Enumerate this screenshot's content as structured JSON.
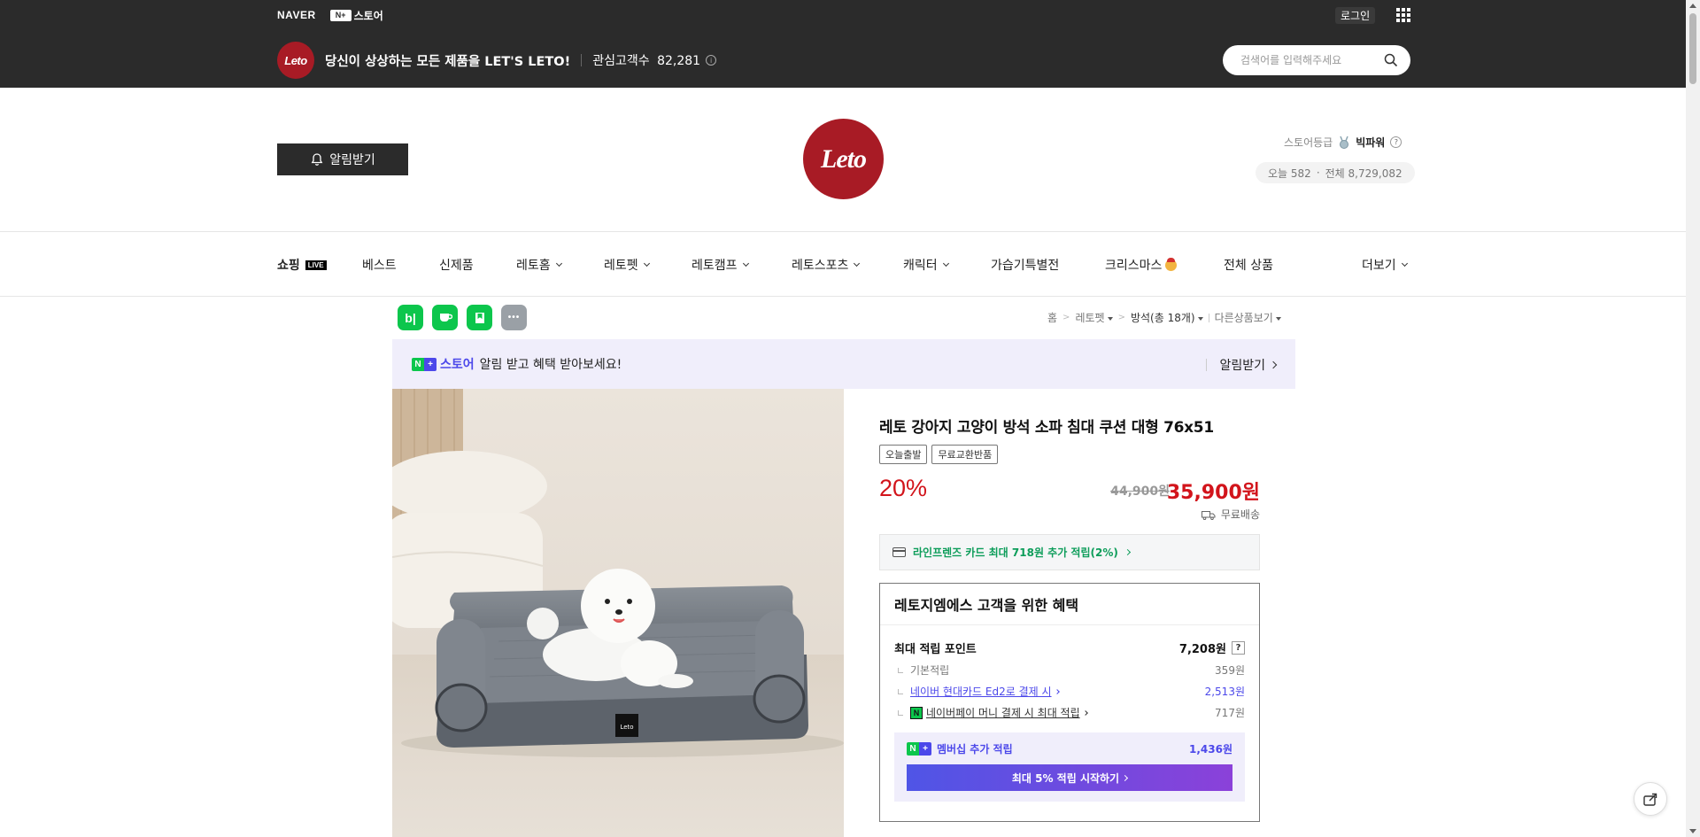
{
  "top": {
    "naver": "NAVER",
    "nstore_box": "N+",
    "nstore_label": "스토어",
    "login": "로그인"
  },
  "store": {
    "avatar_text": "Leto",
    "slogan": "당신이 상상하는 모든 제품을 LET'S LETO!",
    "fav_label": "관심고객수",
    "fav_count": "82,281",
    "search_placeholder": "검색어를 입력해주세요"
  },
  "header": {
    "notify_label": "알림받기",
    "logo_text": "Leto",
    "grade_label": "스토어등급",
    "grade_value": "빅파워",
    "today_label": "오늘 582",
    "total_label": "전체 8,729,082"
  },
  "nav": {
    "shopping_live": "쇼핑",
    "live_badge": "LIVE",
    "items": [
      "베스트",
      "신제품",
      "레토홈",
      "레토펫",
      "레토캠프",
      "레토스포츠",
      "캐릭터",
      "가습기특별전",
      "크리스마스",
      "전체 상품"
    ],
    "more": "더보기"
  },
  "share": {
    "blog": "b|",
    "cafe": "☕",
    "bookmark": "▼",
    "more": "•••"
  },
  "breadcrumb": {
    "home": "홈",
    "category": "레토펫",
    "current": "방석(총 18개)",
    "other": "다른상품보기"
  },
  "promo": {
    "brand": "스토어",
    "text": "알림 받고 혜택 받아보세요!",
    "link": "알림받기"
  },
  "product": {
    "title": "레토 강아지 고양이 방석 소파 침대 쿠션 대형 76x51",
    "tags": [
      "오늘출발",
      "무료교환반품"
    ],
    "discount": "20%",
    "original_price": "44,900원",
    "sale_price": "35,900원",
    "shipping": "무료배송",
    "card_benefit": "라인프렌즈 카드 최대 718원 추가 적립(2%)",
    "image_badge": "Leto"
  },
  "benefit": {
    "title": "레토지엠에스 고객을 위한 혜택",
    "max_point_label": "최대 적립 포인트",
    "max_point_value": "7,208원",
    "rows": [
      {
        "label": "기본적립",
        "value": "359원"
      },
      {
        "label": "네이버 현대카드 Ed2로 결제 시",
        "value": "2,513원"
      },
      {
        "label": "네이버페이 머니 결제 시 최대 적립",
        "value": "717원"
      }
    ],
    "member_label": "멤버십 추가 적립",
    "member_value": "1,436원",
    "member_button": "최대 5% 적립 시작하기"
  },
  "colors": {
    "brand_red": "#a81b25",
    "price_red": "#d2141b",
    "naver_green": "#0cc64c",
    "naver_purple": "#4c48ea",
    "header_dark": "#2b2b2b"
  }
}
